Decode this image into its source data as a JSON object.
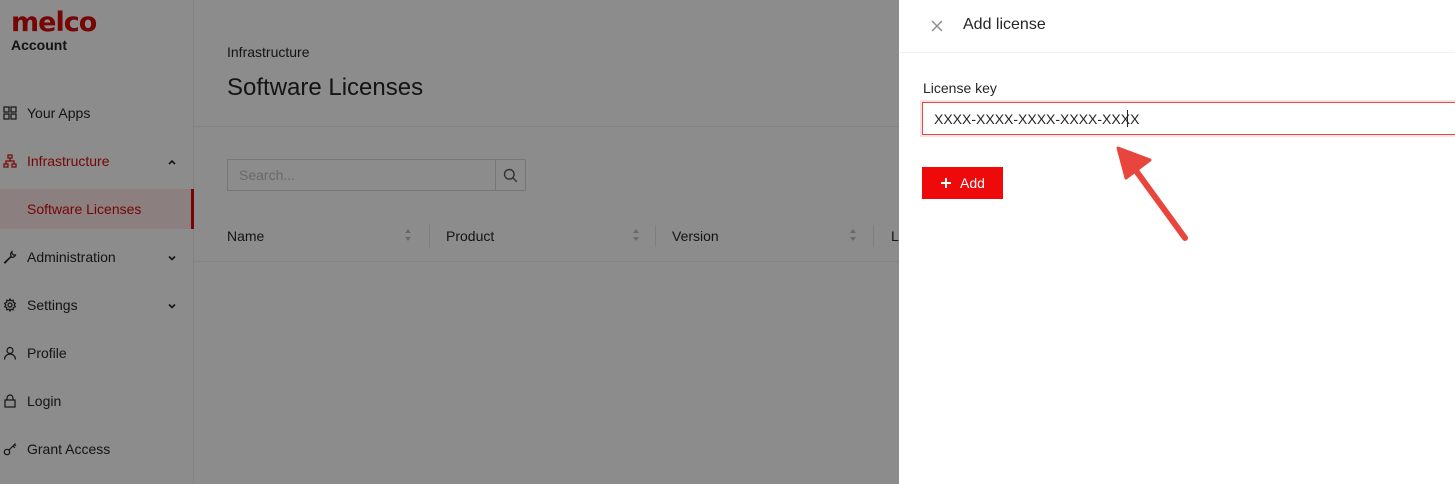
{
  "brand": {
    "logo": "melco",
    "subtitle": "Account"
  },
  "sidebar": {
    "items": [
      {
        "label": "Your Apps",
        "icon": "grid-icon"
      },
      {
        "label": "Infrastructure",
        "icon": "network-icon"
      },
      {
        "label": "Software Licenses"
      },
      {
        "label": "Administration",
        "icon": "wrench-icon"
      },
      {
        "label": "Settings",
        "icon": "gear-icon"
      },
      {
        "label": "Profile",
        "icon": "user-icon"
      },
      {
        "label": "Login",
        "icon": "lock-icon"
      },
      {
        "label": "Grant Access",
        "icon": "key-icon"
      }
    ]
  },
  "page": {
    "breadcrumb": "Infrastructure",
    "title": "Software Licenses",
    "search_placeholder": "Search...",
    "columns": [
      "Name",
      "Product",
      "Version",
      "L"
    ]
  },
  "drawer": {
    "title": "Add license",
    "field_label": "License key",
    "field_value": "XXXX-XXXX-XXXX-XXXX-XXXX",
    "add_label": "Add"
  },
  "colors": {
    "brand_red": "#d80a0a",
    "button_red": "#ee0a0a",
    "active_bg": "#fde8e8",
    "arrow": "#e8453c"
  }
}
